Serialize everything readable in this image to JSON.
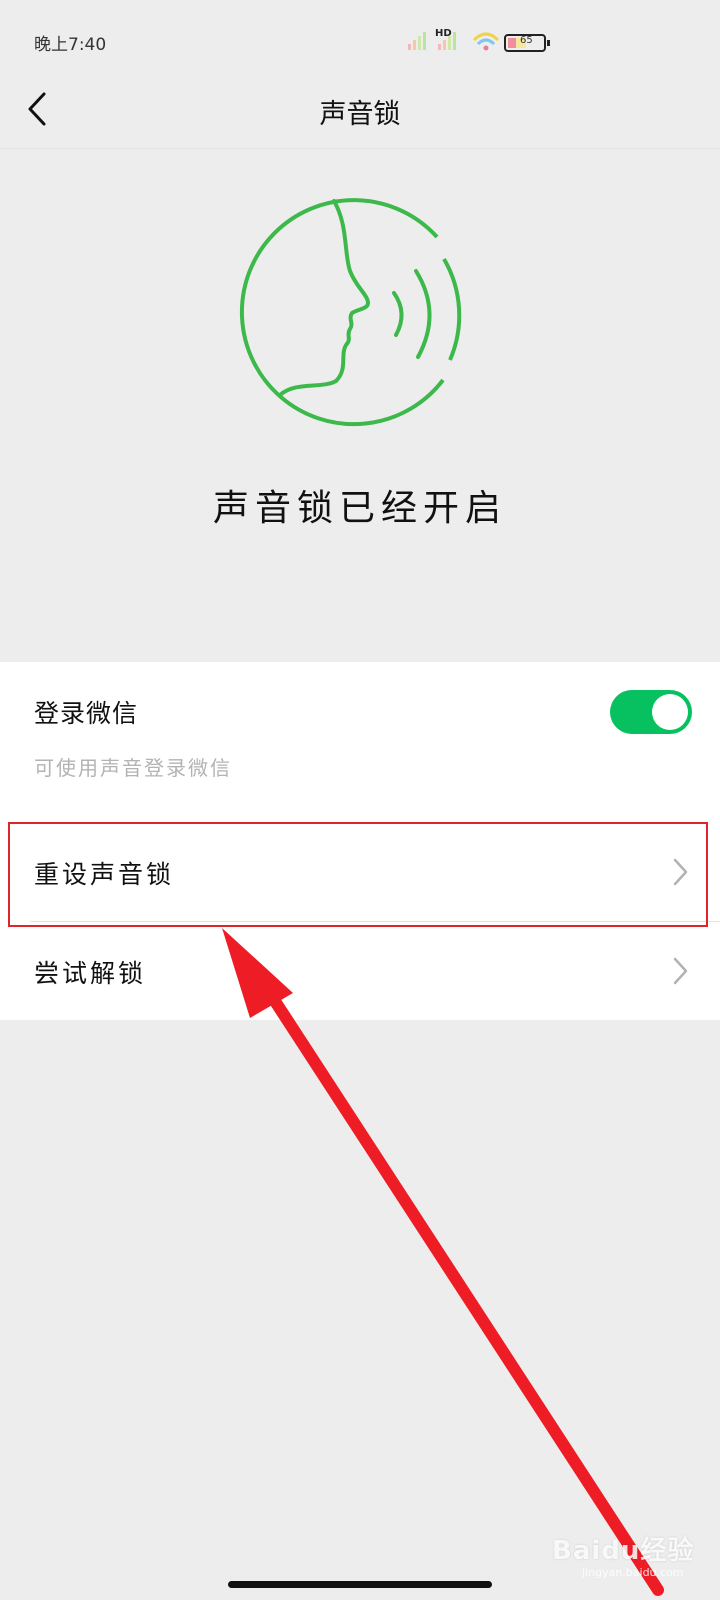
{
  "status_bar": {
    "time": "晚上7:40",
    "network_label": "HD",
    "battery_level": "65"
  },
  "header": {
    "title": "声音锁",
    "back_icon": "chevron-left-icon"
  },
  "hero": {
    "illustration_icon": "voice-face-icon",
    "status_text": "声音锁已经开启"
  },
  "settings": {
    "login": {
      "label": "登录微信",
      "description": "可使用声音登录微信",
      "enabled": true
    },
    "reset": {
      "label": "重设声音锁"
    },
    "try_unlock": {
      "label": "尝试解锁"
    }
  },
  "annotation": {
    "highlight_color": "#e0242b",
    "arrow_color": "#ee1c25"
  },
  "watermark": {
    "brand": "Baidu经验",
    "url": "jingyan.baidu.com"
  },
  "colors": {
    "accent_green": "#07c160",
    "illustration_green": "#3cb94a",
    "background": "#ededed"
  }
}
